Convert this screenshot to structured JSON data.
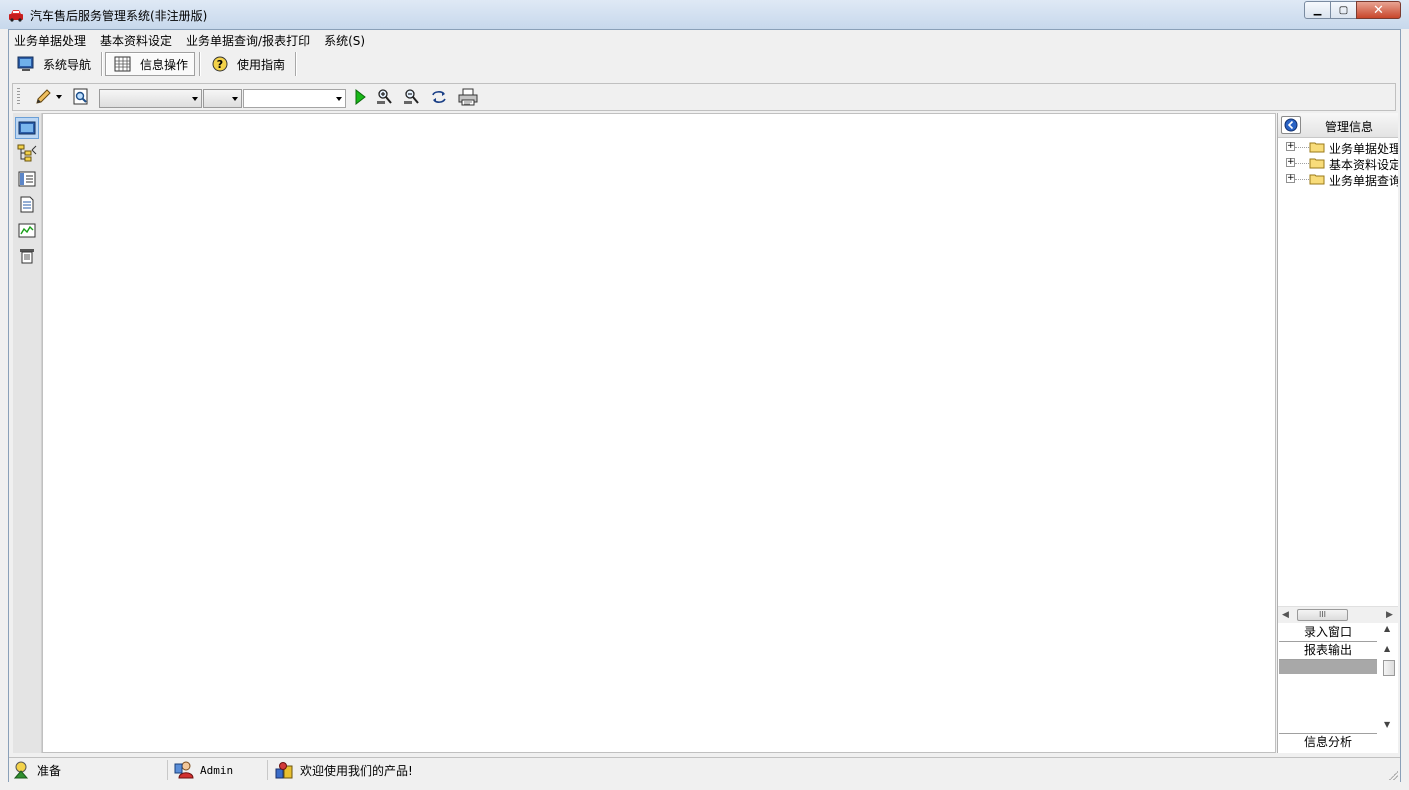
{
  "window": {
    "title": "汽车售后服务管理系统(非注册版)",
    "controls": {
      "minimize": "▁",
      "maximize": "▢",
      "close": "✕"
    }
  },
  "menubar": {
    "items": [
      {
        "label": "业务单据处理"
      },
      {
        "label": "基本资料设定"
      },
      {
        "label": "业务单据查询/报表打印"
      },
      {
        "label": "系统(S)"
      }
    ]
  },
  "navbar": {
    "items": [
      {
        "label": "系统导航",
        "icon": "monitor-icon",
        "active": false
      },
      {
        "label": "信息操作",
        "icon": "grid-icon",
        "active": true
      },
      {
        "label": "使用指南",
        "icon": "help-icon",
        "active": false
      }
    ]
  },
  "toolstrip": {
    "tools": [
      "edit-pencil-icon",
      "dropdown-arrow-icon",
      "find-icon",
      "run-icon",
      "zoom-in-icon",
      "zoom-out-icon",
      "refresh-icon",
      "print-icon"
    ],
    "combo1_value": "",
    "combo2_value": "",
    "combo3_value": ""
  },
  "leftbar": {
    "icons": [
      "window-icon",
      "tree-structure-icon",
      "list-view-icon",
      "document-icon",
      "chart-icon",
      "report-icon"
    ]
  },
  "rightpanel": {
    "title": "管理信息",
    "tree": [
      {
        "label": "业务单据处理"
      },
      {
        "label": "基本资料设定"
      },
      {
        "label": "业务单据查询"
      }
    ],
    "hscroll_thumb": "III",
    "list": [
      {
        "label": "录入窗口"
      },
      {
        "label": "报表输出"
      },
      {
        "label": ""
      }
    ],
    "bottom_item": "信息分析"
  },
  "statusbar": {
    "status": "准备",
    "user": "Admin",
    "message": "欢迎使用我们的产品!"
  }
}
